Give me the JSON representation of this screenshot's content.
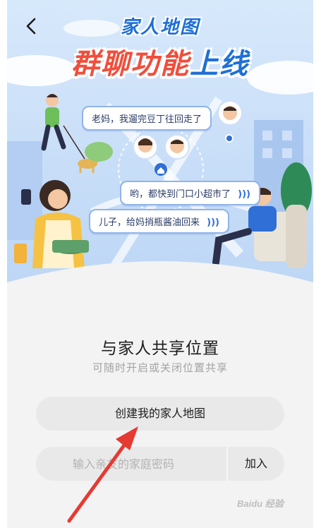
{
  "hero": {
    "title_small": "家人地图",
    "title_big_part1": "群聊功能",
    "title_big_part2": "上线",
    "bubbles": [
      {
        "text": "老妈，我遛完豆丁往回走了"
      },
      {
        "text": "哟，都快到门口小超市了"
      },
      {
        "text": "儿子，给妈捎瓶酱油回来"
      }
    ]
  },
  "content": {
    "heading": "与家人共享位置",
    "subheading": "可随时开启或关闭位置共享",
    "create_button": "创建我的家人地图",
    "join_placeholder": "输入亲友的家庭密码",
    "join_button": "加入"
  },
  "watermark": "Baidu 经验",
  "colors": {
    "brand_blue": "#1f6fd6",
    "brand_red": "#ef4f3c",
    "button_bg": "#e9e9ea",
    "annotation_arrow": "#e53a32"
  }
}
